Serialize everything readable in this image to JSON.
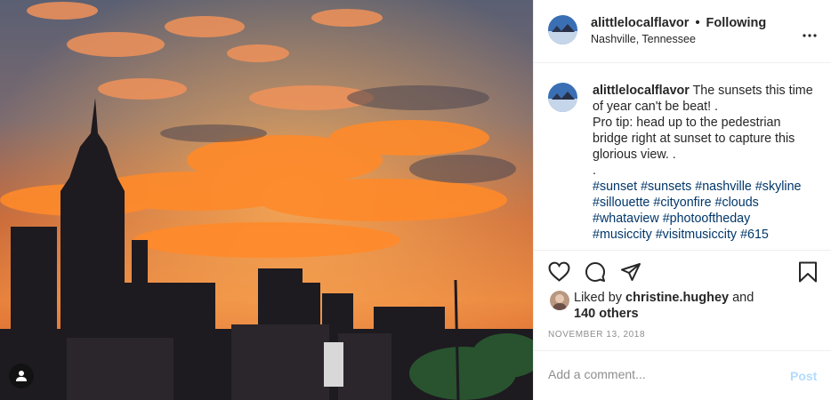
{
  "post": {
    "username": "alittlelocalflavor",
    "separator": "•",
    "follow_status": "Following",
    "location": "Nashville, Tennessee",
    "caption": {
      "username": "alittlelocalflavor",
      "line1": "The sunsets this time",
      "line2": "of year can't be beat! .",
      "line3": "Pro tip: head up to the pedestrian",
      "line4": "bridge right at sunset to capture this",
      "line5": "glorious view. .",
      "line6": ".",
      "hashtags_line1": [
        "#sunset",
        "#sunsets",
        "#nashville",
        "#skyline"
      ],
      "hashtags_line2": [
        "#sillouette",
        "#cityonfire",
        "#clouds"
      ],
      "hashtags_line3": [
        "#whataview",
        "#photooftheday"
      ],
      "hashtags_line4": [
        "#musiccity",
        "#visitmusiccity",
        "#615"
      ]
    },
    "likes": {
      "prefix": "Liked by",
      "liker": "christine.hughey",
      "conjunction": "and",
      "others": "140 others"
    },
    "date": "NOVEMBER 13, 2018",
    "comment_placeholder": "Add a comment...",
    "post_label": "Post"
  },
  "icons": {
    "like": "heart-icon",
    "comment": "comment-icon",
    "share": "share-icon",
    "save": "bookmark-icon",
    "more": "more-options-icon",
    "tag": "user-tag-icon"
  },
  "colors": {
    "hashtag": "#00376b",
    "post_disabled": "#b3dbff",
    "muted": "#8e8e8e",
    "text": "#262626"
  }
}
